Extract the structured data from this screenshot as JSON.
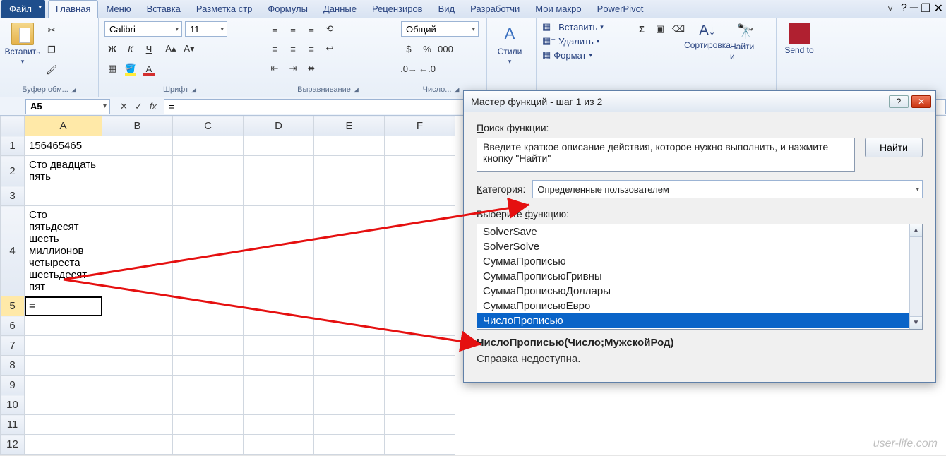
{
  "tabs": {
    "file": "Файл",
    "home": "Главная",
    "menu": "Меню",
    "insert": "Вставка",
    "layout": "Разметка стр",
    "formulas": "Формулы",
    "data": "Данные",
    "review": "Рецензиров",
    "view": "Вид",
    "developer": "Разработчи",
    "macros": "Мои макро",
    "powerpivot": "PowerPivot"
  },
  "ribbon": {
    "clipboard": {
      "paste": "Вставить",
      "label": "Буфер обм..."
    },
    "font": {
      "name": "Calibri",
      "size": "11",
      "label": "Шрифт"
    },
    "alignment": {
      "label": "Выравнивание"
    },
    "number": {
      "format": "Общий",
      "label": "Число..."
    },
    "styles": {
      "label": "Стили"
    },
    "cells": {
      "insert": "Вставить",
      "delete": "Удалить",
      "format": "Формат"
    },
    "editing": {
      "sort": "Сортировка",
      "find": "Найти и"
    },
    "custom": {
      "send": "Send to"
    }
  },
  "fxbar": {
    "namebox": "A5",
    "cancel": "✕",
    "ok": "✓",
    "fx": "fx",
    "formula": "="
  },
  "grid": {
    "cols": [
      "A",
      "B",
      "C",
      "D",
      "E",
      "F"
    ],
    "rows": [
      "1",
      "2",
      "3",
      "4",
      "5",
      "6",
      "7",
      "8",
      "9",
      "10",
      "11",
      "12"
    ],
    "cells": {
      "A1": "156465465",
      "A2": "Сто двадцать пять",
      "A4": "Сто пятьдесят шесть миллионов четыреста шестьдесят пят",
      "A5": "="
    },
    "active": "A5"
  },
  "dialog": {
    "title": "Мастер функций - шаг 1 из 2",
    "search_label": "Поиск функции:",
    "search_text": "Введите краткое описание действия, которое нужно выполнить, и нажмите кнопку \"Найти\"",
    "find_btn": "Найти",
    "category_label": "Категория:",
    "category_value": "Определенные пользователем",
    "select_label": "Выберите функцию:",
    "functions": [
      "SolverSave",
      "SolverSolve",
      "СуммаПрописью",
      "СуммаПрописьюГривны",
      "СуммаПрописьюДоллары",
      "СуммаПрописьюЕвро",
      "ЧислоПрописью"
    ],
    "selected_index": 6,
    "signature": "ЧислоПрописью(Число;МужскойРод)",
    "description": "Справка недоступна."
  },
  "watermark": "user-life.com"
}
